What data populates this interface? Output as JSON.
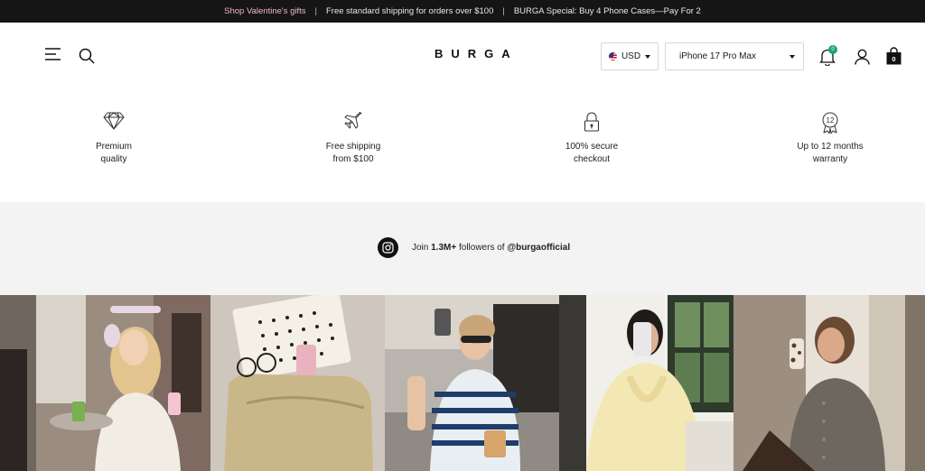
{
  "announcement": {
    "promo": "Shop Valentine's gifts",
    "separator": "|",
    "shipping": "Free standard shipping for orders over $100",
    "special": "BURGA Special: Buy 4 Phone Cases—Pay For 2"
  },
  "header": {
    "logo": "BURGA",
    "currency": "USD",
    "device": "iPhone 17 Pro Max",
    "notification_count": "0",
    "cart_count": "0"
  },
  "features": [
    {
      "line1": "Premium",
      "line2": "quality",
      "icon": "diamond-icon"
    },
    {
      "line1": "Free shipping",
      "line2": "from $100",
      "icon": "airplane-icon"
    },
    {
      "line1": "100% secure",
      "line2": "checkout",
      "icon": "lock-icon"
    },
    {
      "line1": "Up to 12 months",
      "line2": "warranty",
      "icon": "warranty-badge-icon"
    }
  ],
  "social": {
    "prefix": "Join ",
    "count": "1.3M+",
    "middle": " followers of ",
    "handle": "@burgaofficial"
  },
  "colors": {
    "announce_bg": "#151515",
    "promo_pink": "#f1b7c6",
    "social_bg": "#f4f3f3",
    "badge_green": "#1fa36a"
  }
}
